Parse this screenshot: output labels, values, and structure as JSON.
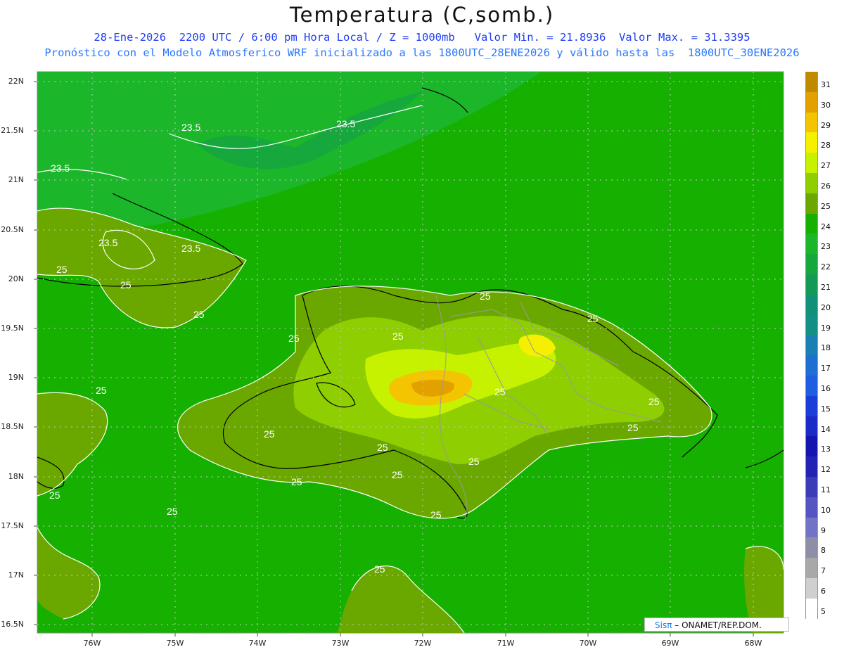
{
  "title": "Temperatura (C,somb.)",
  "subtitle_1": "28-Ene-2026  2200 UTC / 6:00 pm Hora Local / Z = 1000mb   Valor Min. = 21.8936  Valor Max. = 31.3395",
  "subtitle_2": "Pronóstico con el Modelo Atmosferico WRF inicializado a las 1800UTC_28ENE2026 y válido hasta las  1800UTC_30ENE2026",
  "axes": {
    "y_labels": [
      "22N",
      "21.5N",
      "21N",
      "20.5N",
      "20N",
      "19.5N",
      "19N",
      "18.5N",
      "18N",
      "17.5N",
      "17N",
      "16.5N"
    ],
    "x_labels": [
      "76W",
      "75W",
      "74W",
      "73W",
      "72W",
      "71W",
      "70W",
      "69W",
      "68W"
    ]
  },
  "contour_labels": [
    "23.5",
    "23.5",
    "23.5",
    "23.5",
    "23.5",
    "25",
    "25",
    "25",
    "25",
    "25",
    "25",
    "25",
    "25",
    "25",
    "25",
    "25",
    "25",
    "25",
    "25",
    "25",
    "25",
    "25",
    "25",
    "25",
    "25"
  ],
  "colorbar": {
    "levels": [
      "31",
      "30",
      "29",
      "28",
      "27",
      "26",
      "25",
      "24",
      "23",
      "22",
      "21",
      "20",
      "19",
      "18",
      "17",
      "16",
      "15",
      "14",
      "13",
      "12",
      "11",
      "10",
      "9",
      "8",
      "7",
      "6",
      "5"
    ],
    "colors": [
      "#c08a00",
      "#e3a100",
      "#f5c400",
      "#f6f000",
      "#c6f200",
      "#8fce00",
      "#6aa800",
      "#15b000",
      "#1cb62a",
      "#16a73d",
      "#159a55",
      "#13907a",
      "#129085",
      "#1a7fb4",
      "#1f6fd2",
      "#1f5ee0",
      "#1b3fd6",
      "#1a2bc8",
      "#1515b0",
      "#2323b4",
      "#3c3cb8",
      "#5555c2",
      "#7272c6",
      "#8e8ea8",
      "#a8a8a8",
      "#cfcfcf",
      "#ffffff"
    ]
  },
  "credit": {
    "brand": "Sisπ",
    "text": "– ONAMET/REP.DOM."
  }
}
